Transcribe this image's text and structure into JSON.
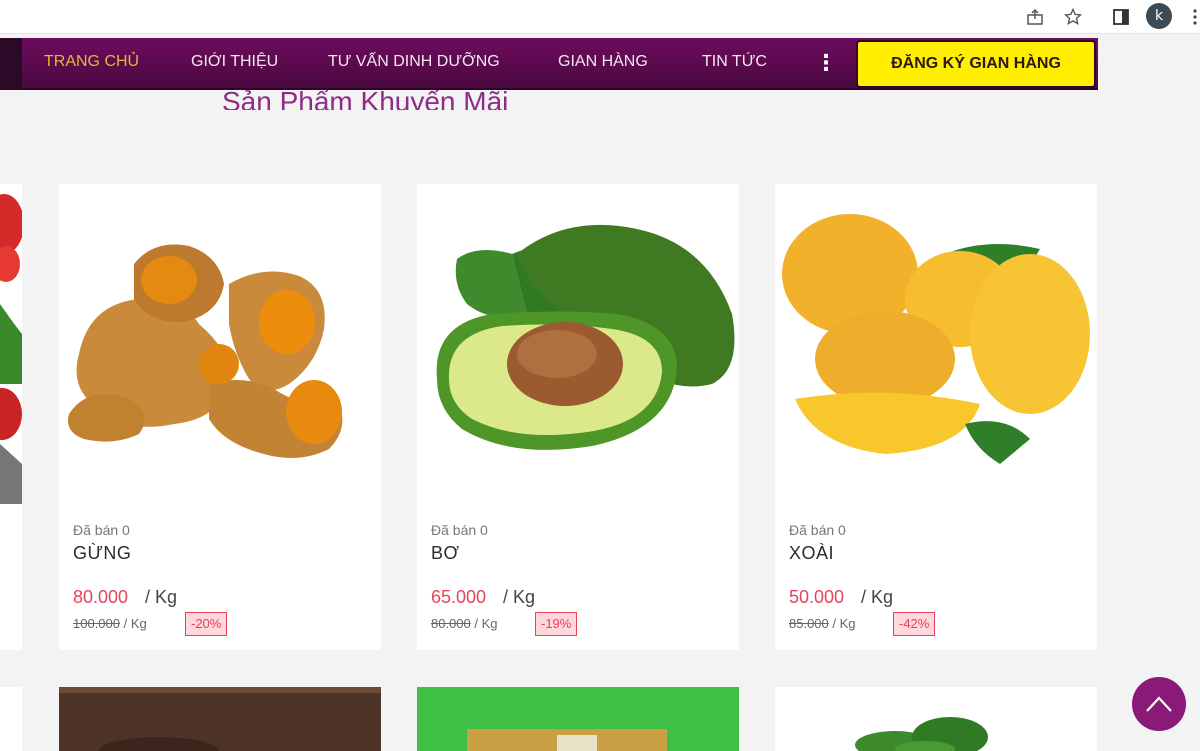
{
  "browser": {
    "avatar_letter": "k",
    "icons": [
      "share-icon",
      "star-icon",
      "sidepanel-icon",
      "menu-icon"
    ]
  },
  "nav": {
    "items": [
      "TRANG CHỦ",
      "GIỚI THIỆU",
      "TƯ VẤN DINH DƯỠNG",
      "GIAN HÀNG",
      "TIN TỨC"
    ],
    "more": "⋮",
    "register": "ĐĂNG KÝ GIAN HÀNG"
  },
  "section_title": "Sản Phẩm Khuyến Mãi",
  "products": [
    {
      "sold": "Đã bán 0",
      "name": "GỪNG",
      "price": "80.000",
      "unit": "/ Kg",
      "old_price": "100.000",
      "old_unit": "/ Kg",
      "discount": "-20%"
    },
    {
      "sold": "Đã bán 0",
      "name": "BƠ",
      "price": "65.000",
      "unit": "/ Kg",
      "old_price": "80.000",
      "old_unit": "/ Kg",
      "discount": "-19%"
    },
    {
      "sold": "Đã bán 0",
      "name": "XOÀI",
      "price": "50.000",
      "unit": "/ Kg",
      "old_price": "85.000",
      "old_unit": "/ Kg",
      "discount": "-42%"
    }
  ],
  "colors": {
    "nav": "#5c0a4e",
    "accent": "#e5b83a",
    "cta": "#ffee00",
    "price": "#e8425a",
    "title": "#8d2d87"
  }
}
